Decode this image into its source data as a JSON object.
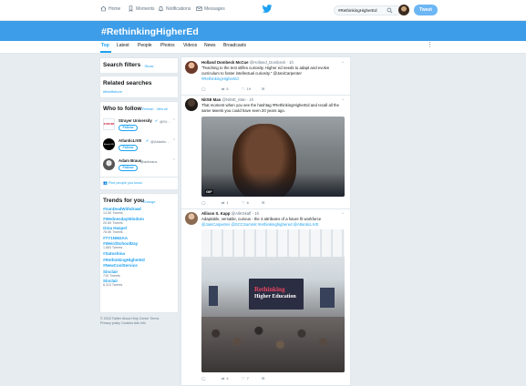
{
  "nav": {
    "home": "Home",
    "moments": "Moments",
    "notifications": "Notifications",
    "messages": "Messages",
    "search_value": "#RethinkingHigherEd",
    "tweet_button": "Tweet"
  },
  "banner": {
    "title": "#RethinkingHigherEd"
  },
  "tabs": [
    "Top",
    "Latest",
    "People",
    "Photos",
    "Videos",
    "News",
    "Broadcasts"
  ],
  "sidebar": {
    "filters_title": "Search filters",
    "filters_show": "· Show",
    "related_title": "Related searches",
    "related_item": "#tbtoffshore",
    "wtf_title": "Who to follow",
    "wtf_refresh": "· Refresh · View all",
    "follow_label": "Follow",
    "follow_users": [
      {
        "name": "Strayer University",
        "handle": "@St…",
        "avatar_text": "STRAYER"
      },
      {
        "name": "AtlanticLIVE",
        "handle": "@Atlantic…",
        "avatar_text": "AtlanticLIVE"
      },
      {
        "name": "Adam Braus",
        "handle": "@adbraus",
        "avatar_text": ""
      }
    ],
    "find_people": "Find people you know",
    "trends_title": "Trends for you",
    "trends_change": "· Change",
    "trends": [
      {
        "tag": "#IranDealWithdrawl",
        "count": "13.5K Tweets"
      },
      {
        "tag": "#WednesdayWisdom",
        "count": "20.6K Tweets"
      },
      {
        "tag": "Gina Haspel",
        "count": "78.5K Tweets"
      },
      {
        "tag": "#TY1NNDAA",
        "count": ""
      },
      {
        "tag": "#WeirdSchoolDay",
        "count": "1,683 Tweets"
      },
      {
        "tag": "#Satoshina",
        "count": ""
      },
      {
        "tag": "#RethinkingHigherEd",
        "count": ""
      },
      {
        "tag": "#NewCoolService",
        "count": ""
      },
      {
        "tag": "Sinclair",
        "count": "71K Tweets"
      },
      {
        "tag": "Sinclair",
        "count": "6,313 Tweets"
      }
    ],
    "footer_line1": "© 2018 Twitter  About  Help Center  Terms",
    "footer_line2": "Privacy policy  Cookies  Ads info"
  },
  "tweets": [
    {
      "name": "Holland Dombeck McCue",
      "handle": "@Holland_Dombeck · 1h",
      "lines": [
        "\"Teaching to the test stifles curiosity. Higher ed needs to adapt and evolve",
        "curriculum to foster intellectual curiosity.\" @JaniCarpenter",
        "#RethinkingHigherEd"
      ],
      "replies": "",
      "retweets": "6",
      "likes": "19"
    },
    {
      "name": "NitSE Man",
      "handle": "@NitSE_Man · 1h",
      "lines": [
        "That moment when you see the hashtag #RethinkingHigherEd and recall all the",
        "same tweets you could have seen 20 years ago."
      ],
      "gif_label": "GIF",
      "replies": "",
      "retweets": "1",
      "likes": "6"
    },
    {
      "name": "Allison S. Kapp",
      "handle": "@AllKSkaff · 1h",
      "lines": [
        "Adaptable, versatile, curious - the 3 attributes of a future fit workforce",
        "@JaniCarpenter @SCCSummit #rethinkinghighered @AtlanticLIVE"
      ],
      "screen_text": [
        "Rethinking",
        "Higher Education"
      ],
      "replies": "",
      "retweets": "4",
      "likes": "7"
    }
  ],
  "colors": {
    "accent": "#1da1f2",
    "banner": "#3d9de8",
    "bg": "#e6ecf0"
  }
}
